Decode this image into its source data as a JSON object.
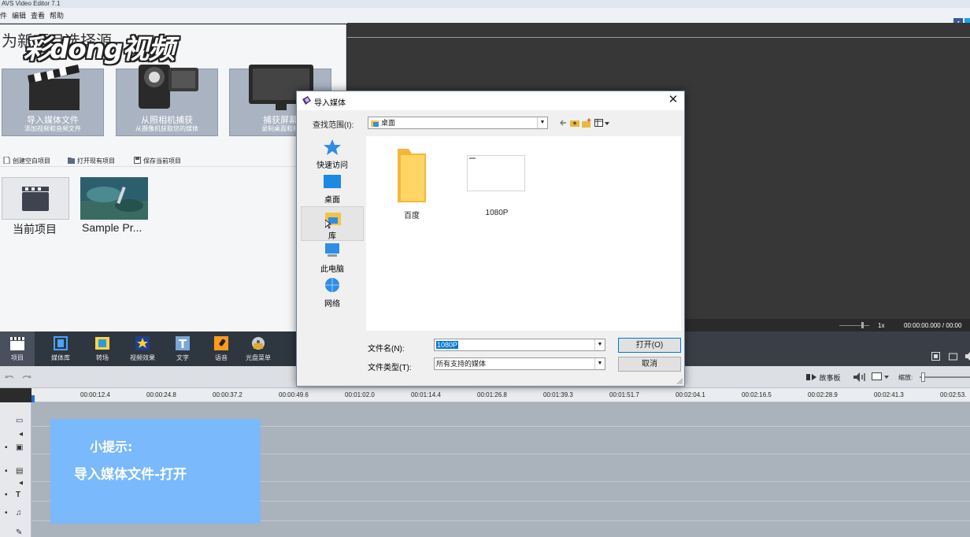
{
  "window": {
    "title": "AVS Video Editor 7.1"
  },
  "menu": [
    "件",
    "编辑",
    "查看",
    "帮助"
  ],
  "watermark": "彩dong视频",
  "left_panel": {
    "title": "为新项目选择源",
    "tiles": [
      {
        "title": "导入媒体文件",
        "subtitle": "添加视频和音频文件"
      },
      {
        "title": "从照相机捕获",
        "subtitle": "从摄像机获取您的媒体"
      },
      {
        "title": "捕获屏幕",
        "subtitle": "录制桌面和程"
      }
    ],
    "actions": [
      "创建空白项目",
      "打开现有项目",
      "保存当前项目"
    ],
    "projects": [
      "当前项目",
      "Sample Pr..."
    ]
  },
  "toolbar": [
    "项目",
    "媒体库",
    "转场",
    "视频效果",
    "文字",
    "语音",
    "光盘菜单"
  ],
  "player": {
    "speed": "1x",
    "time": "00:00:00.000 / 00:00"
  },
  "timeline": {
    "storyboard": "故事板",
    "zoom_label": "缩放:",
    "ticks": [
      "00:00:12.4",
      "00:00:24.8",
      "00:00:37.2",
      "00:00:49.6",
      "00:01:02.0",
      "00:01:14.4",
      "00:01:26.8",
      "00:01:39.3",
      "00:01:51.7",
      "00:02:04.1",
      "00:02:16.5",
      "00:02:28.9",
      "00:02:41.3",
      "00:02:53."
    ]
  },
  "tip": {
    "title": "小提示:",
    "body": "导入媒体文件-打开"
  },
  "dialog": {
    "title": "导入媒体",
    "look_in_label": "查找范围(I):",
    "look_in_value": "桌面",
    "places": [
      "快速访问",
      "桌面",
      "库",
      "此电脑",
      "网络"
    ],
    "files": [
      "百度",
      "1080P"
    ],
    "file_name_label": "文件名(N):",
    "file_name_value": "1080P",
    "file_type_label": "文件类型(T):",
    "file_type_value": "所有支持的媒体",
    "open_button": "打开(O)",
    "cancel_button": "取消"
  },
  "colors": {
    "accent": "#0078d7",
    "tip_bg": "#7ab9fb",
    "toolbar_bg": "#2e3640"
  }
}
